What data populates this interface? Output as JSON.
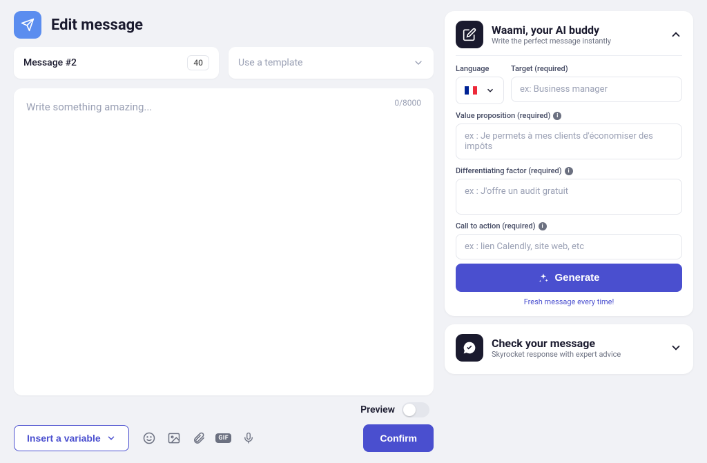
{
  "header": {
    "title": "Edit message"
  },
  "message": {
    "chip_label": "Message #2",
    "badge": "40"
  },
  "template": {
    "placeholder": "Use a template"
  },
  "editor": {
    "placeholder": "Write something amazing...",
    "counter": "0/8000"
  },
  "preview": {
    "label": "Preview"
  },
  "toolbar": {
    "insert_label": "Insert a variable",
    "confirm_label": "Confirm"
  },
  "ai_panel": {
    "title": "Waami, your AI buddy",
    "subtitle": "Write the perfect message instantly",
    "language_label": "Language",
    "target_label": "Target (required)",
    "target_placeholder": "ex: Business manager",
    "value_prop_label": "Value proposition (required)",
    "value_prop_placeholder": "ex : Je permets à mes clients d'économiser des impôts",
    "diff_label": "Differentiating factor (required)",
    "diff_placeholder": "ex : J'offre un audit gratuit",
    "cta_label": "Call to action (required)",
    "cta_placeholder": "ex : lien Calendly, site web, etc",
    "generate_label": "Generate",
    "freshness": "Fresh message every time!",
    "language_selected": "fr"
  },
  "check_panel": {
    "title": "Check your message",
    "subtitle": "Skyrocket response with expert advice"
  }
}
